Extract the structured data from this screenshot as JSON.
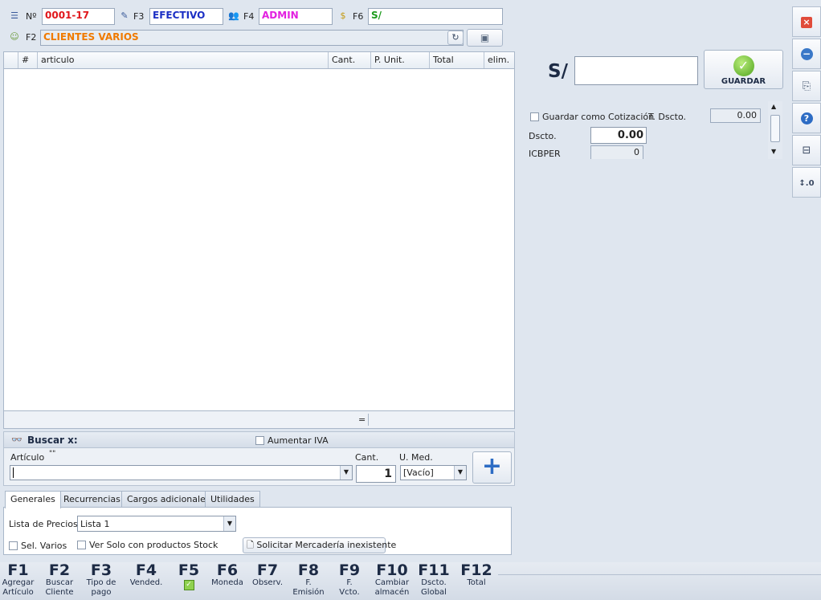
{
  "header": {
    "num_label": "Nº",
    "num_value": "0001-17",
    "f3_label": "F3",
    "f3_value": "EFECTIVO",
    "f4_label": "F4",
    "f4_value": "ADMIN",
    "f6_label": "F6",
    "f6_value": "S/",
    "f2_label": "F2",
    "f2_value": "CLIENTES VARIOS"
  },
  "grid": {
    "columns": [
      "#",
      "articulo",
      "Cant.",
      "P. Unit.",
      "Total",
      "elim."
    ],
    "footer_sum": "="
  },
  "search": {
    "title": "Buscar x:",
    "aumentar_iva": "Aumentar IVA",
    "articulo_label": "Artículo",
    "articulo_hint": "\"\"",
    "cant_label": "Cant.",
    "cant_value": "1",
    "umed_label": "U. Med.",
    "umed_value": "[Vacío]"
  },
  "tabs": [
    "Generales",
    "Recurrencias",
    "Cargos adicionales",
    "Utilidades"
  ],
  "generales": {
    "lista_label": "Lista de Precios",
    "lista_value": "Lista 1",
    "sel_varios": "Sel. Varios",
    "ver_solo": "Ver Solo con productos Stock",
    "solicitar": "Solicitar Mercadería inexistente"
  },
  "total_panel": {
    "currency": "S/",
    "total_value": "",
    "guardar": "GUARDAR",
    "guardar_cotizacion": "Guardar como Cotización",
    "t_dscto_label": "T. Dscto.",
    "t_dscto_value": "0.00",
    "dscto_label": "Dscto.",
    "dscto_value": "0.00",
    "icbper_label": "ICBPER",
    "icbper_value": "0"
  },
  "fkeys": [
    {
      "key": "F1",
      "l1": "Agregar",
      "l2": "Artículo"
    },
    {
      "key": "F2",
      "l1": "Buscar",
      "l2": "Cliente"
    },
    {
      "key": "F3",
      "l1": "Tipo de",
      "l2": "pago"
    },
    {
      "key": "F4",
      "l1": "Vended.",
      "l2": ""
    },
    {
      "key": "F5",
      "l1": "",
      "l2": ""
    },
    {
      "key": "F6",
      "l1": "Moneda",
      "l2": ""
    },
    {
      "key": "F7",
      "l1": "Observ.",
      "l2": ""
    },
    {
      "key": "F8",
      "l1": "F.",
      "l2": "Emisión"
    },
    {
      "key": "F9",
      "l1": "F.",
      "l2": "Vcto."
    },
    {
      "key": "F10",
      "l1": "Cambiar",
      "l2": "almacén"
    },
    {
      "key": "F11",
      "l1": "Dscto.",
      "l2": "Global"
    },
    {
      "key": "F12",
      "l1": "Total",
      "l2": ""
    }
  ],
  "colors": {
    "num": "#e0161b",
    "f3": "#1b2fc4",
    "f4": "#e21fe0",
    "f6": "#1c9b1c",
    "f2": "#f07a00"
  }
}
